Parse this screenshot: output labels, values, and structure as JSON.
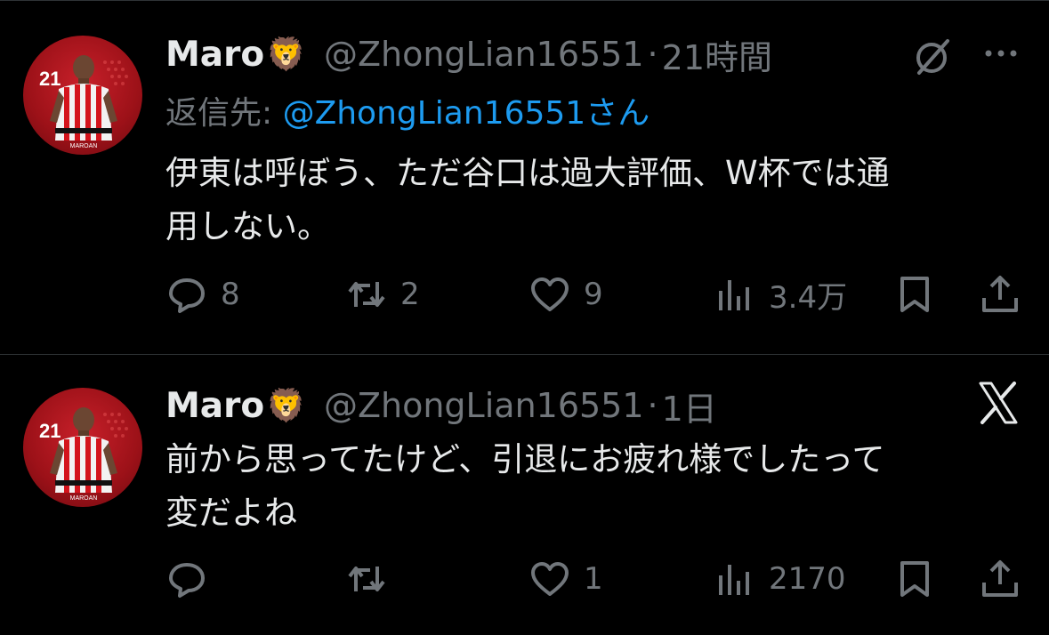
{
  "tweets": [
    {
      "author_name": "Maro",
      "author_emoji": "🦁",
      "handle": "@ZhongLian16551",
      "separator": "·",
      "time": "21時間",
      "reply_prefix": "返信先: ",
      "reply_mention": "@ZhongLian16551さん",
      "text_lines": [
        "伊東は呼ぼう、ただ谷口は過大評価、W杯では通",
        "用しない。"
      ],
      "reply_count": "8",
      "retweet_count": "2",
      "like_count": "9",
      "view_count": "3.4万",
      "avatar_number": "21",
      "avatar_caption": "MAROAN"
    },
    {
      "author_name": "Maro",
      "author_emoji": "🦁",
      "handle": "@ZhongLian16551",
      "separator": "·",
      "time": "1日",
      "text_lines": [
        "前から思ってたけど、引退にお疲れ様でしたって",
        "変だよね"
      ],
      "reply_count": "",
      "retweet_count": "",
      "like_count": "1",
      "view_count": "2170",
      "avatar_number": "21",
      "avatar_caption": "MAROAN"
    }
  ],
  "icons": {
    "reply": "speech-bubble-icon",
    "retweet": "retweet-arrows-icon",
    "like": "heart-icon",
    "views": "bar-chart-icon",
    "bookmark": "bookmark-icon",
    "share": "share-upload-icon",
    "grok": "grok-slash-circle-icon",
    "more": "ellipsis-icon",
    "x_logo": "x-logo-icon"
  },
  "colors": {
    "background": "#000000",
    "text": "#e7e9ea",
    "muted": "#71767b",
    "link": "#1d9bf0",
    "divider": "#2f3336"
  }
}
